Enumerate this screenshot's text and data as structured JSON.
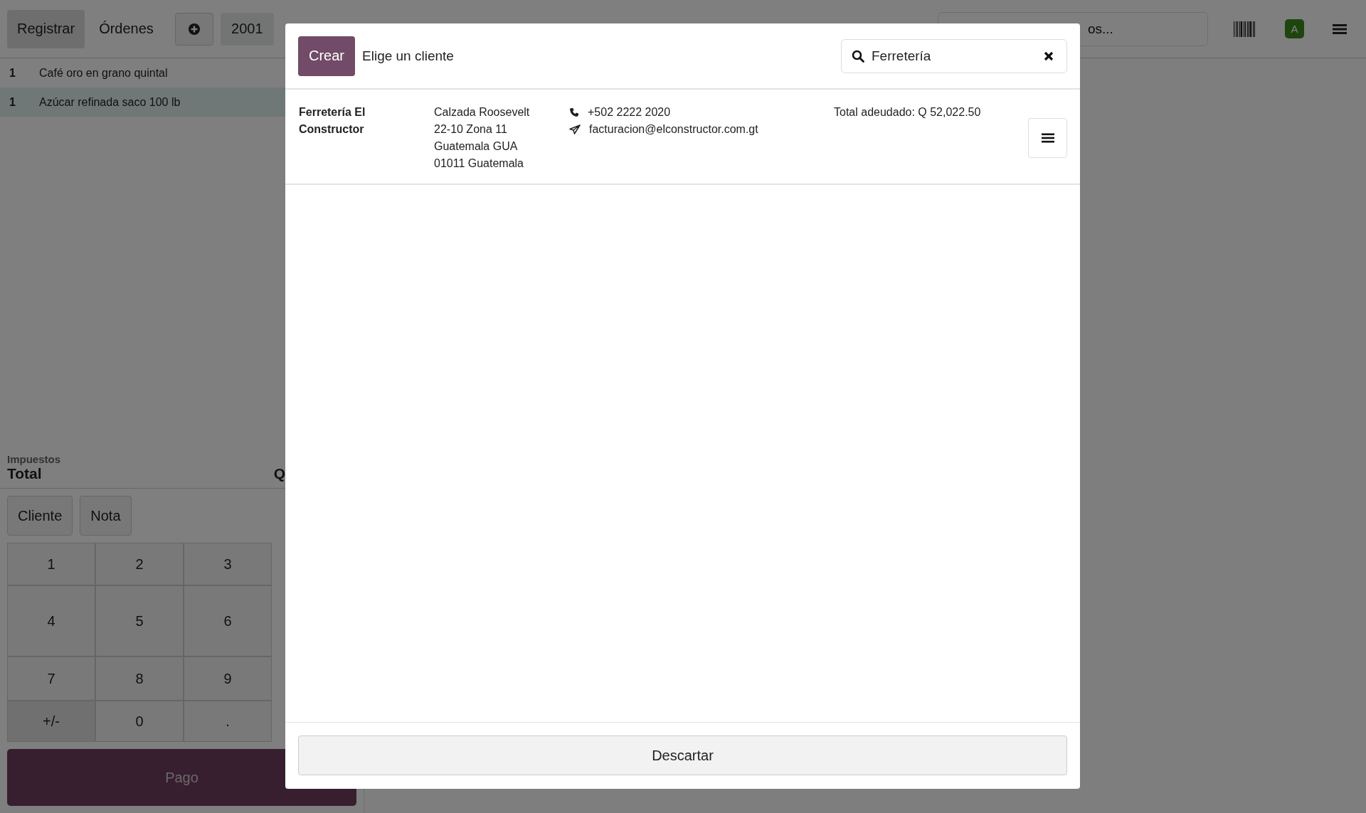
{
  "topbar": {
    "tabs": [
      {
        "label": "Registrar",
        "selected": true
      },
      {
        "label": "Órdenes",
        "selected": false
      }
    ],
    "order_number": "2001",
    "search": {
      "placeholder": "os..."
    },
    "avatar": "A"
  },
  "order_lines": [
    {
      "qty": "1",
      "name": "Café oro en grano quintal",
      "selected": false
    },
    {
      "qty": "1",
      "name": "Azúcar refinada saco 100 lb",
      "selected": true
    }
  ],
  "summary": {
    "taxes_label": "Impuestos",
    "total_label": "Total",
    "total_value": "Q"
  },
  "actions": [
    "Cliente",
    "Nota"
  ],
  "numpad": [
    {
      "label": "1",
      "kind": "digit"
    },
    {
      "label": "2",
      "kind": "digit"
    },
    {
      "label": "3",
      "kind": "digit"
    },
    {
      "label": "4",
      "kind": "digit"
    },
    {
      "label": "5",
      "kind": "digit"
    },
    {
      "label": "6",
      "kind": "digit"
    },
    {
      "label": "7",
      "kind": "digit"
    },
    {
      "label": "8",
      "kind": "digit"
    },
    {
      "label": "9",
      "kind": "digit"
    },
    {
      "label": "+/-",
      "kind": "sign"
    },
    {
      "label": "0",
      "kind": "digit"
    },
    {
      "label": ".",
      "kind": "digit"
    }
  ],
  "pay_button": "Pago",
  "dialog": {
    "create_button": "Crear",
    "title": "Elige un cliente",
    "search": {
      "value": "Ferretería"
    },
    "customers": [
      {
        "name": "Ferretería El Constructor",
        "address": [
          "Calzada Roosevelt",
          "22-10 Zona 11",
          "Guatemala GUA",
          "01011 Guatemala"
        ],
        "phone": "+502 2222 2020",
        "email": "facturacion@elconstructor.com.gt",
        "balance": "Total adeudado: Q 52,022.50"
      }
    ],
    "discard_button": "Descartar"
  }
}
